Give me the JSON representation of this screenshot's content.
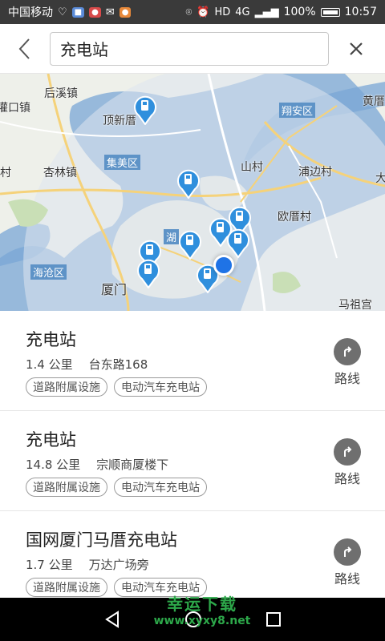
{
  "status_bar": {
    "carrier": "中国移动",
    "network": "4G",
    "battery": "100%",
    "time": "10:57"
  },
  "search": {
    "value": "充电站"
  },
  "map": {
    "labels": {
      "houxi": "后溪镇",
      "jiankou": "灌口镇",
      "dingxincuo": "顶新厝",
      "jimei": "集美区",
      "xinglin": "杏林镇",
      "cun": "村",
      "haicang": "海沧区",
      "xiamen": "厦门",
      "hu": "湖",
      "shancun": "山村",
      "pubiancun": "浦边村",
      "oucuocun": "欧厝村",
      "xiangan": "翔安区",
      "huangcuo": "黄厝",
      "mazuhong": "马祖宫",
      "da": "大"
    }
  },
  "results": [
    {
      "title": "充电站",
      "distance": "1.4 公里",
      "address": "台东路168",
      "tags": [
        "道路附属设施",
        "电动汽车充电站"
      ],
      "route_label": "路线"
    },
    {
      "title": "充电站",
      "distance": "14.8 公里",
      "address": "宗顺商厦楼下",
      "tags": [
        "道路附属设施",
        "电动汽车充电站"
      ],
      "route_label": "路线"
    },
    {
      "title": "国网厦门马厝充电站",
      "distance": "1.7 公里",
      "address": "万达广场旁",
      "tags": [
        "道路附属设施",
        "电动汽车充电站"
      ],
      "route_label": "路线"
    }
  ],
  "watermark": {
    "line1": "幸运下载",
    "line2": "www.xyxy8.net"
  },
  "colors": {
    "status_bar": "#3a3a3a",
    "map_water": "#7aa7d6",
    "pin": "#2f8fdd",
    "location_dot": "#1f73e6",
    "route_icon": "#6f6f6f"
  }
}
